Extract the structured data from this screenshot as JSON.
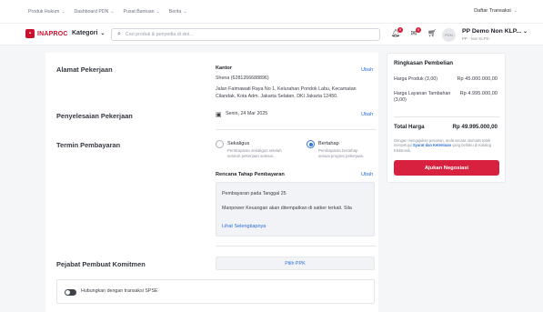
{
  "topbar": {
    "links": [
      "Produk Hukum",
      "Dashboard PDN",
      "Pusat Bantuan",
      "Berita"
    ],
    "transactions": "Daftar Transaksi"
  },
  "header": {
    "logo_text": "INAPROC",
    "kategori": "Kategori",
    "search_placeholder": "Cari produk & penyedia di sini...",
    "notif_counts": [
      "9",
      "9",
      ""
    ],
    "avatar_text": "PDN",
    "account_name": "PP Demo Non KLP...",
    "account_sub": "PP - Non KLPD"
  },
  "alamat": {
    "title": "Alamat Pekerjaan",
    "label": "Kantor",
    "edit": "Ubah",
    "contact": "Shena (6281266688896)",
    "address_line1": "Jalan Fatmawati Raya No 1, Kelurahan Pondok Labu, Kecamatan",
    "address_line2": "Cilandak, Kota Adm. Jakarta Selatan, DKI Jakarta 12450."
  },
  "penyelesaian": {
    "title": "Penyelesaian Pekerjaan",
    "date": "Senin, 24 Mar 2025",
    "edit": "Ubah"
  },
  "termin": {
    "title": "Termin Pembayaran",
    "options": [
      {
        "label": "Sekaligus",
        "desc1": "Pembayaran sekaligus setelah",
        "desc2": "seluruh pekerjaan selesai.",
        "selected": false
      },
      {
        "label": "Bertahap",
        "desc1": "Pembayaran bertahap",
        "desc2": "sesuai progres pekerjaan.",
        "selected": true
      }
    ],
    "plan_title": "Rencana Tahap Pembayaran",
    "plan_edit": "Ubah",
    "plan_line1": "Pembayaran pada Tanggal 25",
    "plan_line2": "Manpower Keuangan akan ditempatkan di satker terkait. Sila",
    "see_more": "Lihat Selengkapnya"
  },
  "pejabat": {
    "title": "Pejabat Pembuat Komitmen",
    "button": "Pilih PPK",
    "toggle_label": "Hubungkan dengan transaksi SPSE",
    "toggle_on": false
  },
  "summary": {
    "title": "Ringkasan Pembelian",
    "rows": [
      {
        "label": "Harga Produk (3,00)",
        "value": "Rp 45.000.000,00"
      },
      {
        "label": "Harga Layanan Tambahan",
        "label2": "(3,00)",
        "value": "Rp 4.995.000,00"
      }
    ],
    "total_label": "Total Harga",
    "total_value": "Rp 49.995.000,00",
    "note_prefix": "Dengan mengajukan pesanan, anda secara otomatis telah menyetujui",
    "note_link": "Syarat dan Ketentuan",
    "note_suffix": "yang berlaku di Katalog Elektronik.",
    "button": "Ajukan Negosiasi"
  },
  "colors": {
    "accent_red": "#d7213f",
    "link_blue": "#2b6fd6",
    "page_bg": "#f5f6f8"
  }
}
